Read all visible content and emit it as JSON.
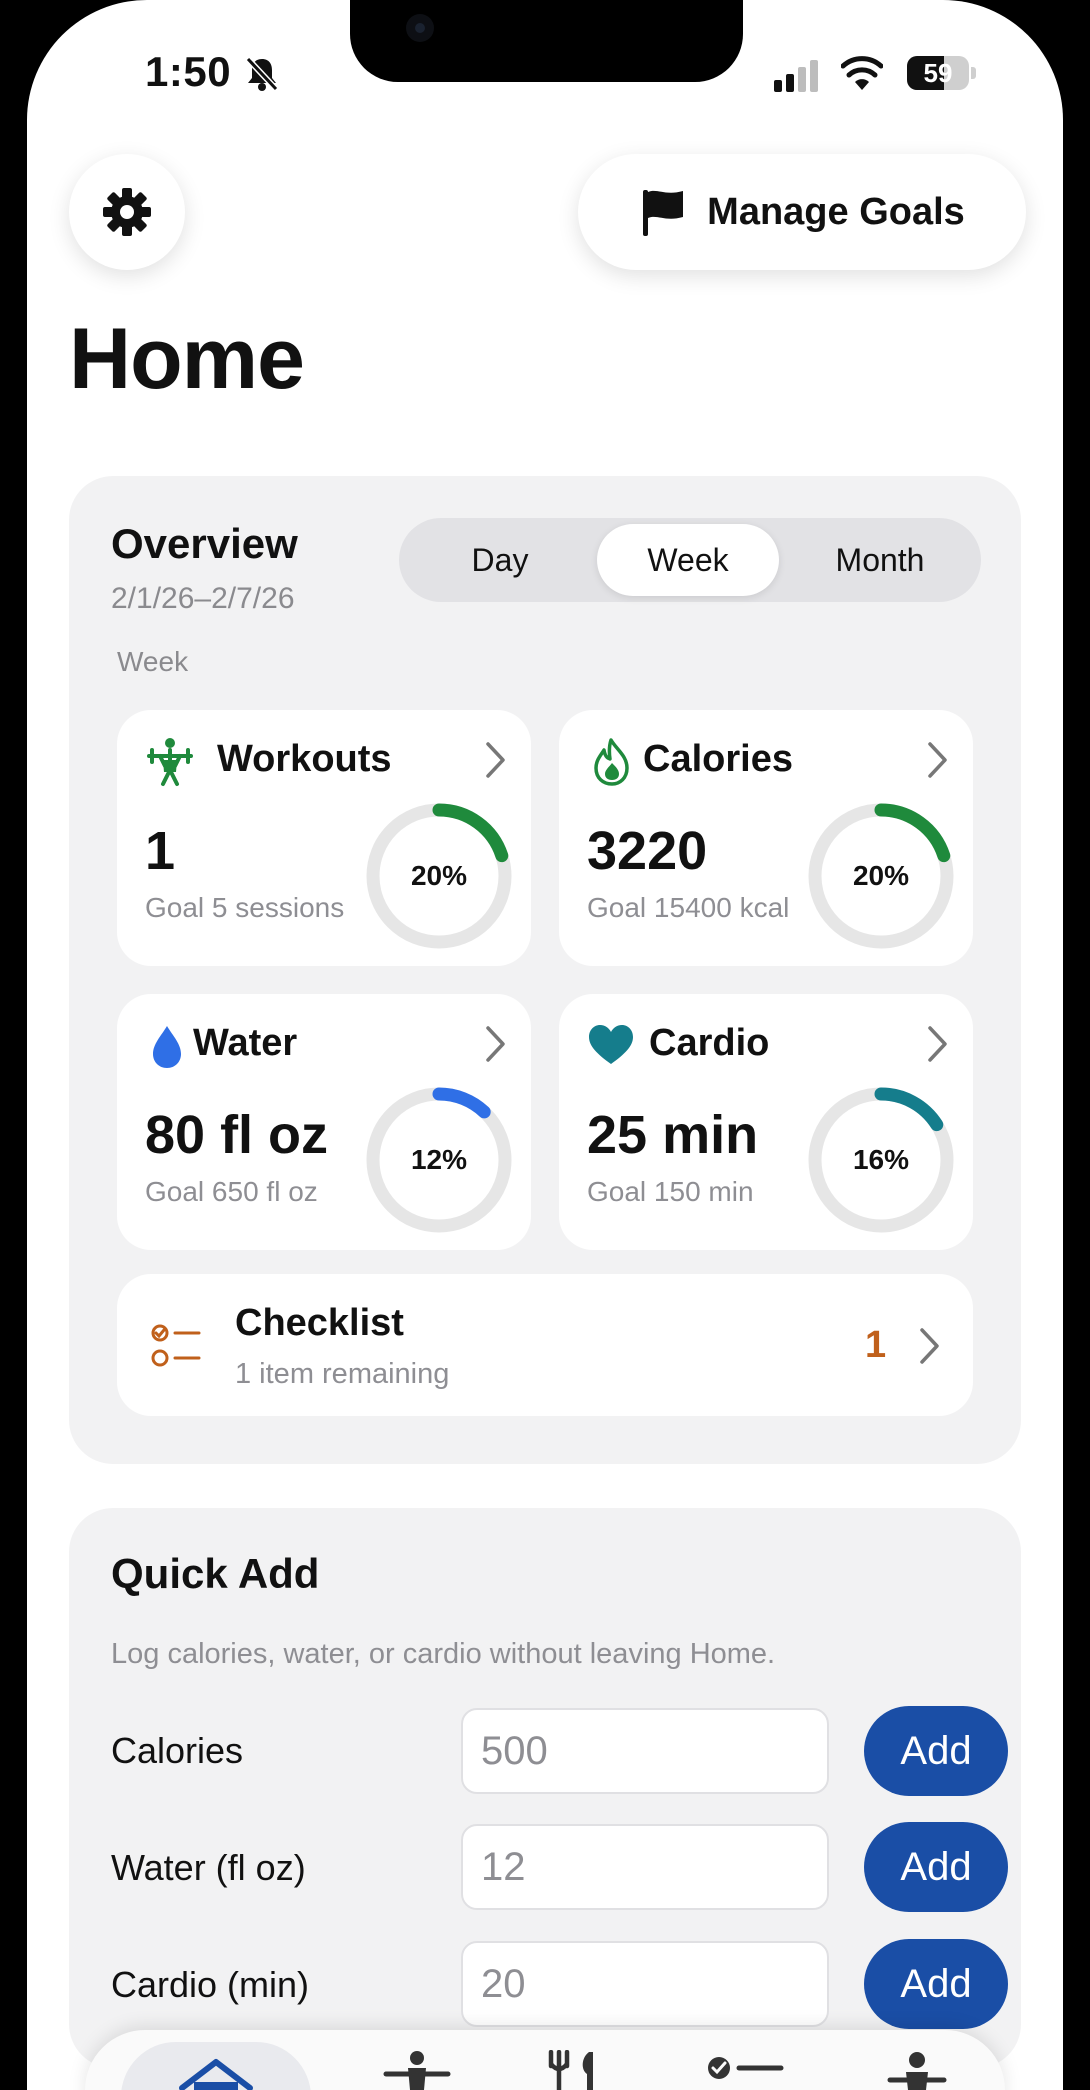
{
  "status": {
    "time": "1:50",
    "battery": "59",
    "battery_level": 0.59
  },
  "header": {
    "manage_goals_label": "Manage Goals",
    "page_title": "Home"
  },
  "overview": {
    "title": "Overview",
    "date_range": "2/1/26–2/7/26",
    "period_label": "Week",
    "segments": [
      "Day",
      "Week",
      "Month"
    ],
    "selected_segment": "Week",
    "cards": [
      {
        "title": "Workouts",
        "value": "1",
        "goal": "Goal 5 sessions",
        "percent_label": "20%",
        "progress": 0.2,
        "color": "#1f8a3c",
        "icon": "weightlifter-icon"
      },
      {
        "title": "Calories",
        "value": "3220",
        "goal": "Goal 15400 kcal",
        "percent_label": "20%",
        "progress": 0.2,
        "color": "#1f8a3c",
        "icon": "flame-icon"
      },
      {
        "title": "Water",
        "value": "80 fl oz",
        "goal": "Goal 650 fl oz",
        "percent_label": "12%",
        "progress": 0.12,
        "color": "#2f6fe6",
        "icon": "water-drop-icon"
      },
      {
        "title": "Cardio",
        "value": "25 min",
        "goal": "Goal 150 min",
        "percent_label": "16%",
        "progress": 0.16,
        "color": "#157d8c",
        "icon": "heart-icon"
      }
    ],
    "checklist": {
      "title": "Checklist",
      "subtitle": "1 item remaining",
      "count": "1",
      "accent": "#c0601b"
    }
  },
  "quick_add": {
    "title": "Quick Add",
    "description": "Log calories, water, or cardio without leaving Home.",
    "rows": [
      {
        "label": "Calories",
        "placeholder": "500",
        "button": "Add"
      },
      {
        "label": "Water (fl oz)",
        "placeholder": "12",
        "button": "Add"
      },
      {
        "label": "Cardio (min)",
        "placeholder": "20",
        "button": "Add"
      }
    ]
  },
  "tabs": [
    "home-icon",
    "workout-icon",
    "fork-knife-icon",
    "checklist-icon",
    "person-icon"
  ],
  "colors": {
    "accent_button": "#1a4ea6",
    "panel_bg": "#f2f2f3"
  }
}
